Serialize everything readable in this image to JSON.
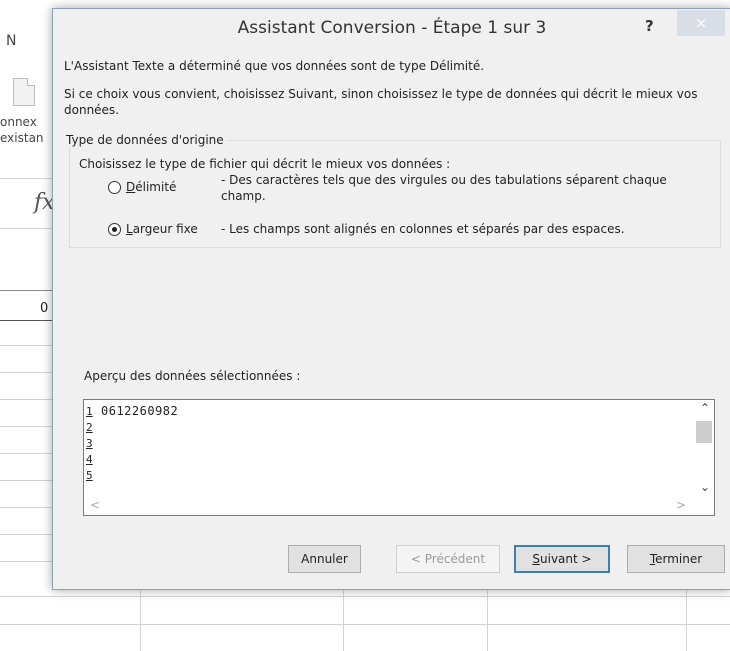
{
  "background": {
    "ribbon_letter": "N",
    "connection_line1": "onnex",
    "connection_line2": "existan",
    "fx_label": "fx",
    "cell_value": "0"
  },
  "dialog": {
    "title": "Assistant Conversion - Étape 1 sur 3",
    "help": "?",
    "close": "×",
    "intro_line1": "L'Assistant Texte a déterminé que vos données sont de type Délimité.",
    "intro_line2": "Si ce choix vous convient, choisissez Suivant, sinon choisissez le type de données qui décrit le mieux vos données.",
    "group_title": "Type de données d'origine",
    "group_instruction": "Choisissez le type de fichier qui décrit le mieux vos données :",
    "options": [
      {
        "label_first": "D",
        "label_rest": "élimité",
        "description": "- Des caractères tels que des virgules ou des tabulations séparent chaque champ.",
        "selected": false
      },
      {
        "label_first": "L",
        "label_rest": "argeur fixe",
        "description": "- Les champs sont alignés en colonnes et séparés par des espaces.",
        "selected": true
      }
    ],
    "preview_label": "Aperçu des données sélectionnées :",
    "preview_rows": [
      "1",
      "2",
      "3",
      "4",
      "5"
    ],
    "preview_data": "0612260982",
    "buttons": {
      "cancel": "Annuler",
      "previous": "< Précédent",
      "next_first": "S",
      "next_rest": "uivant >",
      "finish_first": "T",
      "finish_rest": "erminer"
    }
  }
}
